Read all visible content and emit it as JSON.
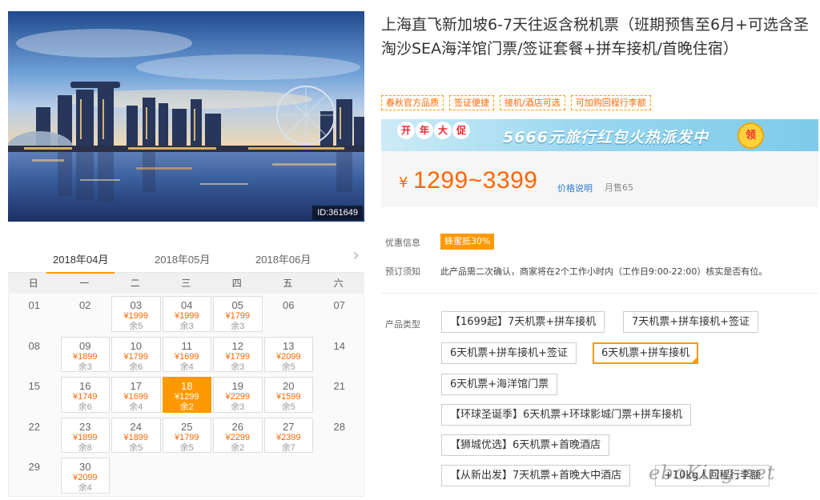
{
  "product": {
    "title": "上海直飞新加坡6-7天往返含税机票（班期预售至6月+可选含圣淘沙SEA海洋馆门票/签证套餐+拼车接机/首晚住宿）",
    "image_id": "ID:361649",
    "tags": [
      "春秋官方品质",
      "签证便捷",
      "接机/酒店可选",
      "可加购回程行李额"
    ]
  },
  "banner": {
    "badge_chars": [
      "开",
      "年",
      "大",
      "促"
    ],
    "text": "5666元旅行红包火热派发中",
    "coin": "领"
  },
  "price": {
    "yen": "¥",
    "range": "1299~3399",
    "note": "价格说明",
    "sold": "月售65"
  },
  "discount": {
    "label": "优惠信息",
    "badge": "蜂蜜抵30%"
  },
  "booking": {
    "label": "预订须知",
    "text": "此产品需二次确认，商家将在2个工作小时内（工作日9:00-22:00）核实是否有位。"
  },
  "product_type": {
    "label": "产品类型",
    "options": [
      "【1699起】7天机票+拼车接机",
      "7天机票+拼车接机+签证",
      "6天机票+拼车接机+签证",
      "6天机票+拼车接机",
      "6天机票+海洋馆门票",
      "【环球圣诞季】6天机票+环球影城门票+拼车接机",
      "【狮城优选】6天机票+首晚酒店",
      "【从新出发】7天机票+首晚大中酒店",
      "+10kg人回程行李额"
    ],
    "selected_index": 3
  },
  "calendar": {
    "months": [
      "2018年04月",
      "2018年05月",
      "2018年06月"
    ],
    "active_month": 0,
    "next_icon": "chevron-right-icon",
    "weekdays": [
      "日",
      "一",
      "二",
      "三",
      "四",
      "五",
      "六"
    ],
    "days": [
      {
        "d": "01"
      },
      {
        "d": "02"
      },
      {
        "d": "03",
        "price": "¥1999",
        "stock": "余5"
      },
      {
        "d": "04",
        "price": "¥1999",
        "stock": "余3"
      },
      {
        "d": "05",
        "price": "¥1799",
        "stock": "余3"
      },
      {
        "d": "06"
      },
      {
        "d": "07"
      },
      {
        "d": "08"
      },
      {
        "d": "09",
        "price": "¥1899",
        "stock": "余3"
      },
      {
        "d": "10",
        "price": "¥1799",
        "stock": "余6"
      },
      {
        "d": "11",
        "price": "¥1699",
        "stock": "余4"
      },
      {
        "d": "12",
        "price": "¥1799",
        "stock": "余3"
      },
      {
        "d": "13",
        "price": "¥2099",
        "stock": "余5"
      },
      {
        "d": "14"
      },
      {
        "d": "15"
      },
      {
        "d": "16",
        "price": "¥1749",
        "stock": "余6"
      },
      {
        "d": "17",
        "price": "¥1699",
        "stock": "余4"
      },
      {
        "d": "18",
        "price": "¥1299",
        "stock": "余2",
        "selected": true
      },
      {
        "d": "19",
        "price": "¥2299",
        "stock": "余3"
      },
      {
        "d": "20",
        "price": "¥1599",
        "stock": "余5"
      },
      {
        "d": "21"
      },
      {
        "d": "22"
      },
      {
        "d": "23",
        "price": "¥1899",
        "stock": "余8"
      },
      {
        "d": "24",
        "price": "¥1899",
        "stock": "余5"
      },
      {
        "d": "25",
        "price": "¥1799",
        "stock": "余5"
      },
      {
        "d": "26",
        "price": "¥2299",
        "stock": "余2"
      },
      {
        "d": "27",
        "price": "¥2399",
        "stock": "余7"
      },
      {
        "d": "28"
      },
      {
        "d": "29"
      },
      {
        "d": "30",
        "price": "¥2099",
        "stock": "余4"
      }
    ]
  },
  "watermark": "eboKing.net",
  "colors": {
    "accent": "#ff9900",
    "price": "#ff6600",
    "link": "#2b7bd6"
  }
}
